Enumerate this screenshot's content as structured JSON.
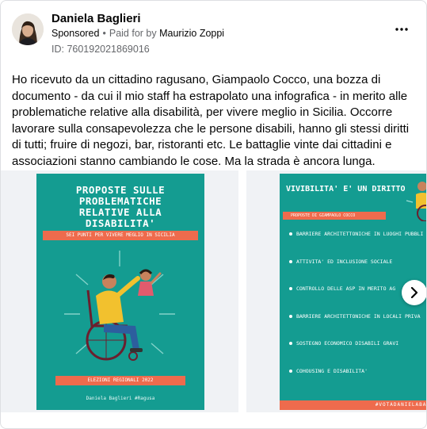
{
  "post": {
    "author": "Daniela Baglieri",
    "sponsored": "Sponsored",
    "paid_for": "Paid for by",
    "payer": "Maurizio Zoppi",
    "ad_id": "ID: 760192021869016",
    "text": "Ho ricevuto da un cittadino ragusano, Giampaolo Cocco, una bozza di documento - da cui il mio staff ha estrapolato una infografica - in merito alle problematiche relative alla disabilità, per vivere meglio in Sicilia. Occorre lavorare sulla consapevolezza che le persone disabili, hanno gli stessi diritti di tutti; fruire di negozi, bar, ristoranti etc. Le battaglie vinte dai cittadini e associazioni stanno cambiando le cose. Ma la strada è ancora lunga."
  },
  "slide1": {
    "title": "PROPOSTE SULLE\nPROBLEMATICHE\nRELATIVE ALLA\nDISABILITA'",
    "band": "SEI PUNTI PER VIVERE MEGLIO IN SICILIA",
    "election": "ELEZIONI REGIONALI 2022",
    "footer": "Daniela Baglieri #Ragusa"
  },
  "slide2": {
    "title": "VIVIBILITA' E' UN DIRITTO",
    "band": "PROPOSTE DI GIAMPAOLO COCCO",
    "items": [
      "BARRIERE ARCHITETTONICHE IN LUOGHI PUBBLI",
      "ATTIVITA' ED INCLUSIONE SOCIALE",
      "CONTROLLO DELLE ASP IN MERITO AG",
      "BARRIERE ARCHITETTONICHE IN LOCALI PRIVA",
      "SOSTEGNO ECONOMICO DISABILI GRAVI",
      "COHOUSING E DISABILITA'"
    ],
    "footer": "#VOTADANIELABAG"
  },
  "colors": {
    "teal": "#149c91",
    "coral": "#ee6b4d",
    "meta_gray": "#65676b"
  },
  "icons": {
    "more": "more-horizontal-icon",
    "next": "chevron-right-icon"
  }
}
